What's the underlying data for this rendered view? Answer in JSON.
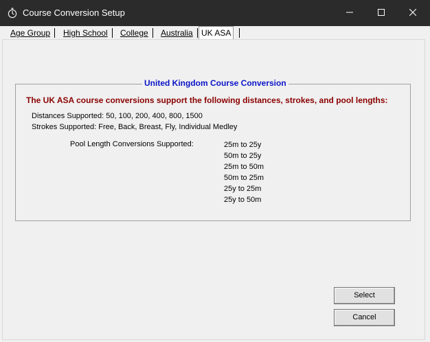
{
  "window": {
    "title": "Course Conversion Setup",
    "icon": "stopwatch-icon"
  },
  "titlebar_buttons": {
    "minimize_icon": "minimize-icon",
    "maximize_icon": "maximize-icon",
    "close_icon": "close-icon"
  },
  "tabs": [
    {
      "label": "Age Group",
      "active": false
    },
    {
      "label": "High School",
      "active": false
    },
    {
      "label": "College",
      "active": false
    },
    {
      "label": "Australia",
      "active": false
    },
    {
      "label": "UK ASA",
      "active": true
    }
  ],
  "group": {
    "title": "United Kingdom Course Conversion",
    "headline": "The UK ASA course conversions support the following distances, strokes, and pool lengths:",
    "distances": "Distances Supported: 50, 100, 200, 400, 800, 1500",
    "strokes": "Strokes Supported: Free, Back, Breast, Fly, Individual Medley",
    "pool_label": "Pool Length Conversions Supported:",
    "pool_conversions": [
      "25m to 25y",
      "50m to 25y",
      "25m to 50m",
      "50m to 25m",
      "25y to 25m",
      "25y to 50m"
    ]
  },
  "buttons": {
    "select": "Select",
    "cancel": "Cancel"
  },
  "colors": {
    "group_title": "#0a14c8",
    "headline": "#8b0000",
    "titlebar": "#2b2b2b"
  }
}
